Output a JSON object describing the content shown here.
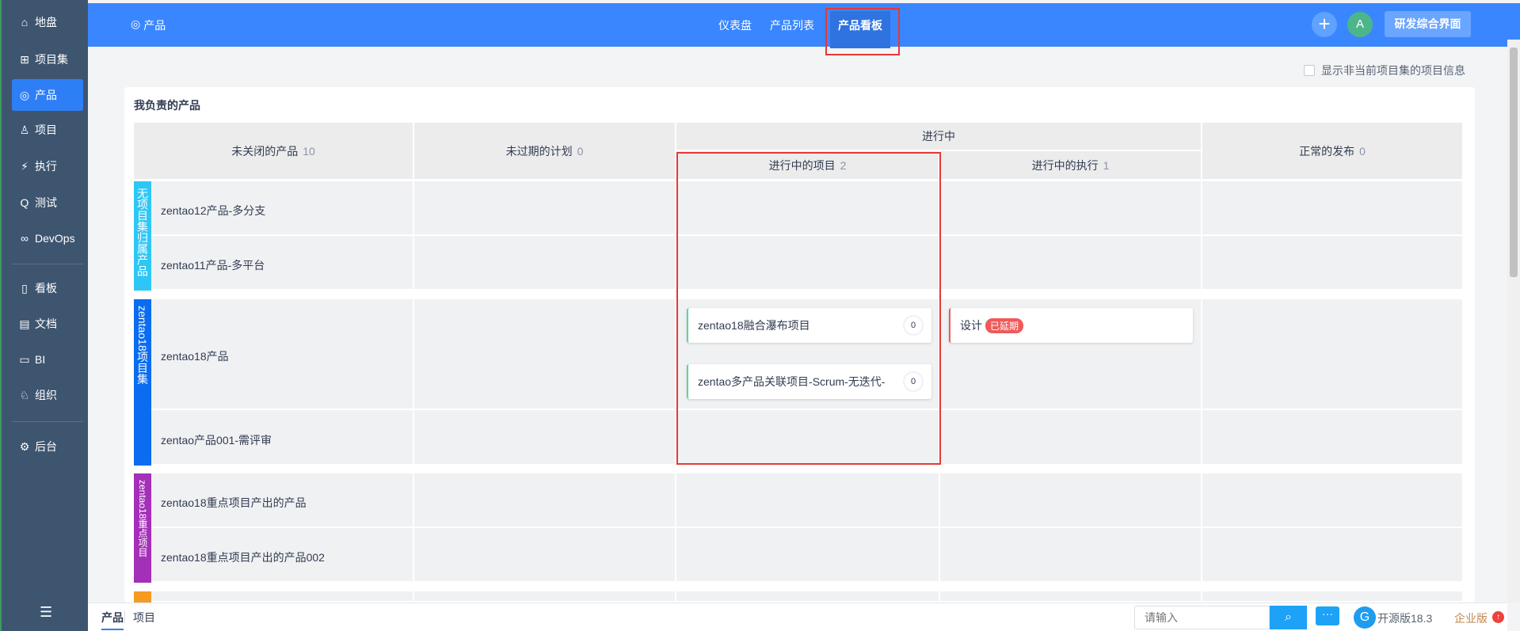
{
  "sidebar": {
    "items": [
      {
        "label": "地盘",
        "icon": "home-icon"
      },
      {
        "label": "项目集",
        "icon": "grid-icon"
      },
      {
        "label": "产品",
        "icon": "bulb-icon"
      },
      {
        "label": "项目",
        "icon": "rocket-icon"
      },
      {
        "label": "执行",
        "icon": "run-icon"
      },
      {
        "label": "测试",
        "icon": "test-icon"
      },
      {
        "label": "DevOps",
        "icon": "infinity-icon"
      },
      {
        "label": "看板",
        "icon": "kanban-icon"
      },
      {
        "label": "文档",
        "icon": "doc-icon"
      },
      {
        "label": "BI",
        "icon": "chart-icon"
      },
      {
        "label": "组织",
        "icon": "user-icon"
      },
      {
        "label": "后台",
        "icon": "gear-icon"
      }
    ],
    "active": "产品"
  },
  "header": {
    "module": "产品",
    "nav": [
      "仪表盘",
      "产品列表",
      "产品看板"
    ],
    "active_nav": "产品看板",
    "avatar": "A",
    "app_button": "研发综合界面"
  },
  "options": {
    "show_other_label": "显示非当前项目集的项目信息",
    "show_other_checked": false
  },
  "board": {
    "title": "我负责的产品",
    "columns": {
      "products": {
        "label": "未关闭的产品",
        "count": "10"
      },
      "plans": {
        "label": "未过期的计划",
        "count": "0"
      },
      "in_progress": "进行中",
      "projects": {
        "label": "进行中的项目",
        "count": "2"
      },
      "executions": {
        "label": "进行中的执行",
        "count": "1"
      },
      "releases": {
        "label": "正常的发布",
        "count": "0"
      }
    },
    "groups": [
      {
        "name": "无项目集归属产品",
        "color": "#2ec7f5",
        "products": [
          "zentao12产品-多分支",
          "zentao11产品-多平台"
        ]
      },
      {
        "name": "zentao18项目集",
        "color": "#0a6cf0",
        "products": [
          "zentao18产品",
          "zentao产品001-需评审"
        ],
        "projects": [
          {
            "name": "zentao18融合瀑布项目",
            "progress": "0"
          },
          {
            "name": "zentao多产品关联项目-Scrum-无迭代-",
            "progress": "0"
          }
        ],
        "executions": [
          {
            "name": "设计",
            "badge": "已延期"
          }
        ]
      },
      {
        "name": "zentao18重点项目",
        "color": "#a42fb8",
        "products": [
          "zentao18重点项目产出的产品",
          "zentao18重点项目产出的产品002"
        ]
      }
    ]
  },
  "bottom": {
    "tabs": [
      "产品",
      "项目"
    ],
    "search_placeholder": "请输入",
    "version": "开源版18.3",
    "enterprise": "企业版"
  }
}
